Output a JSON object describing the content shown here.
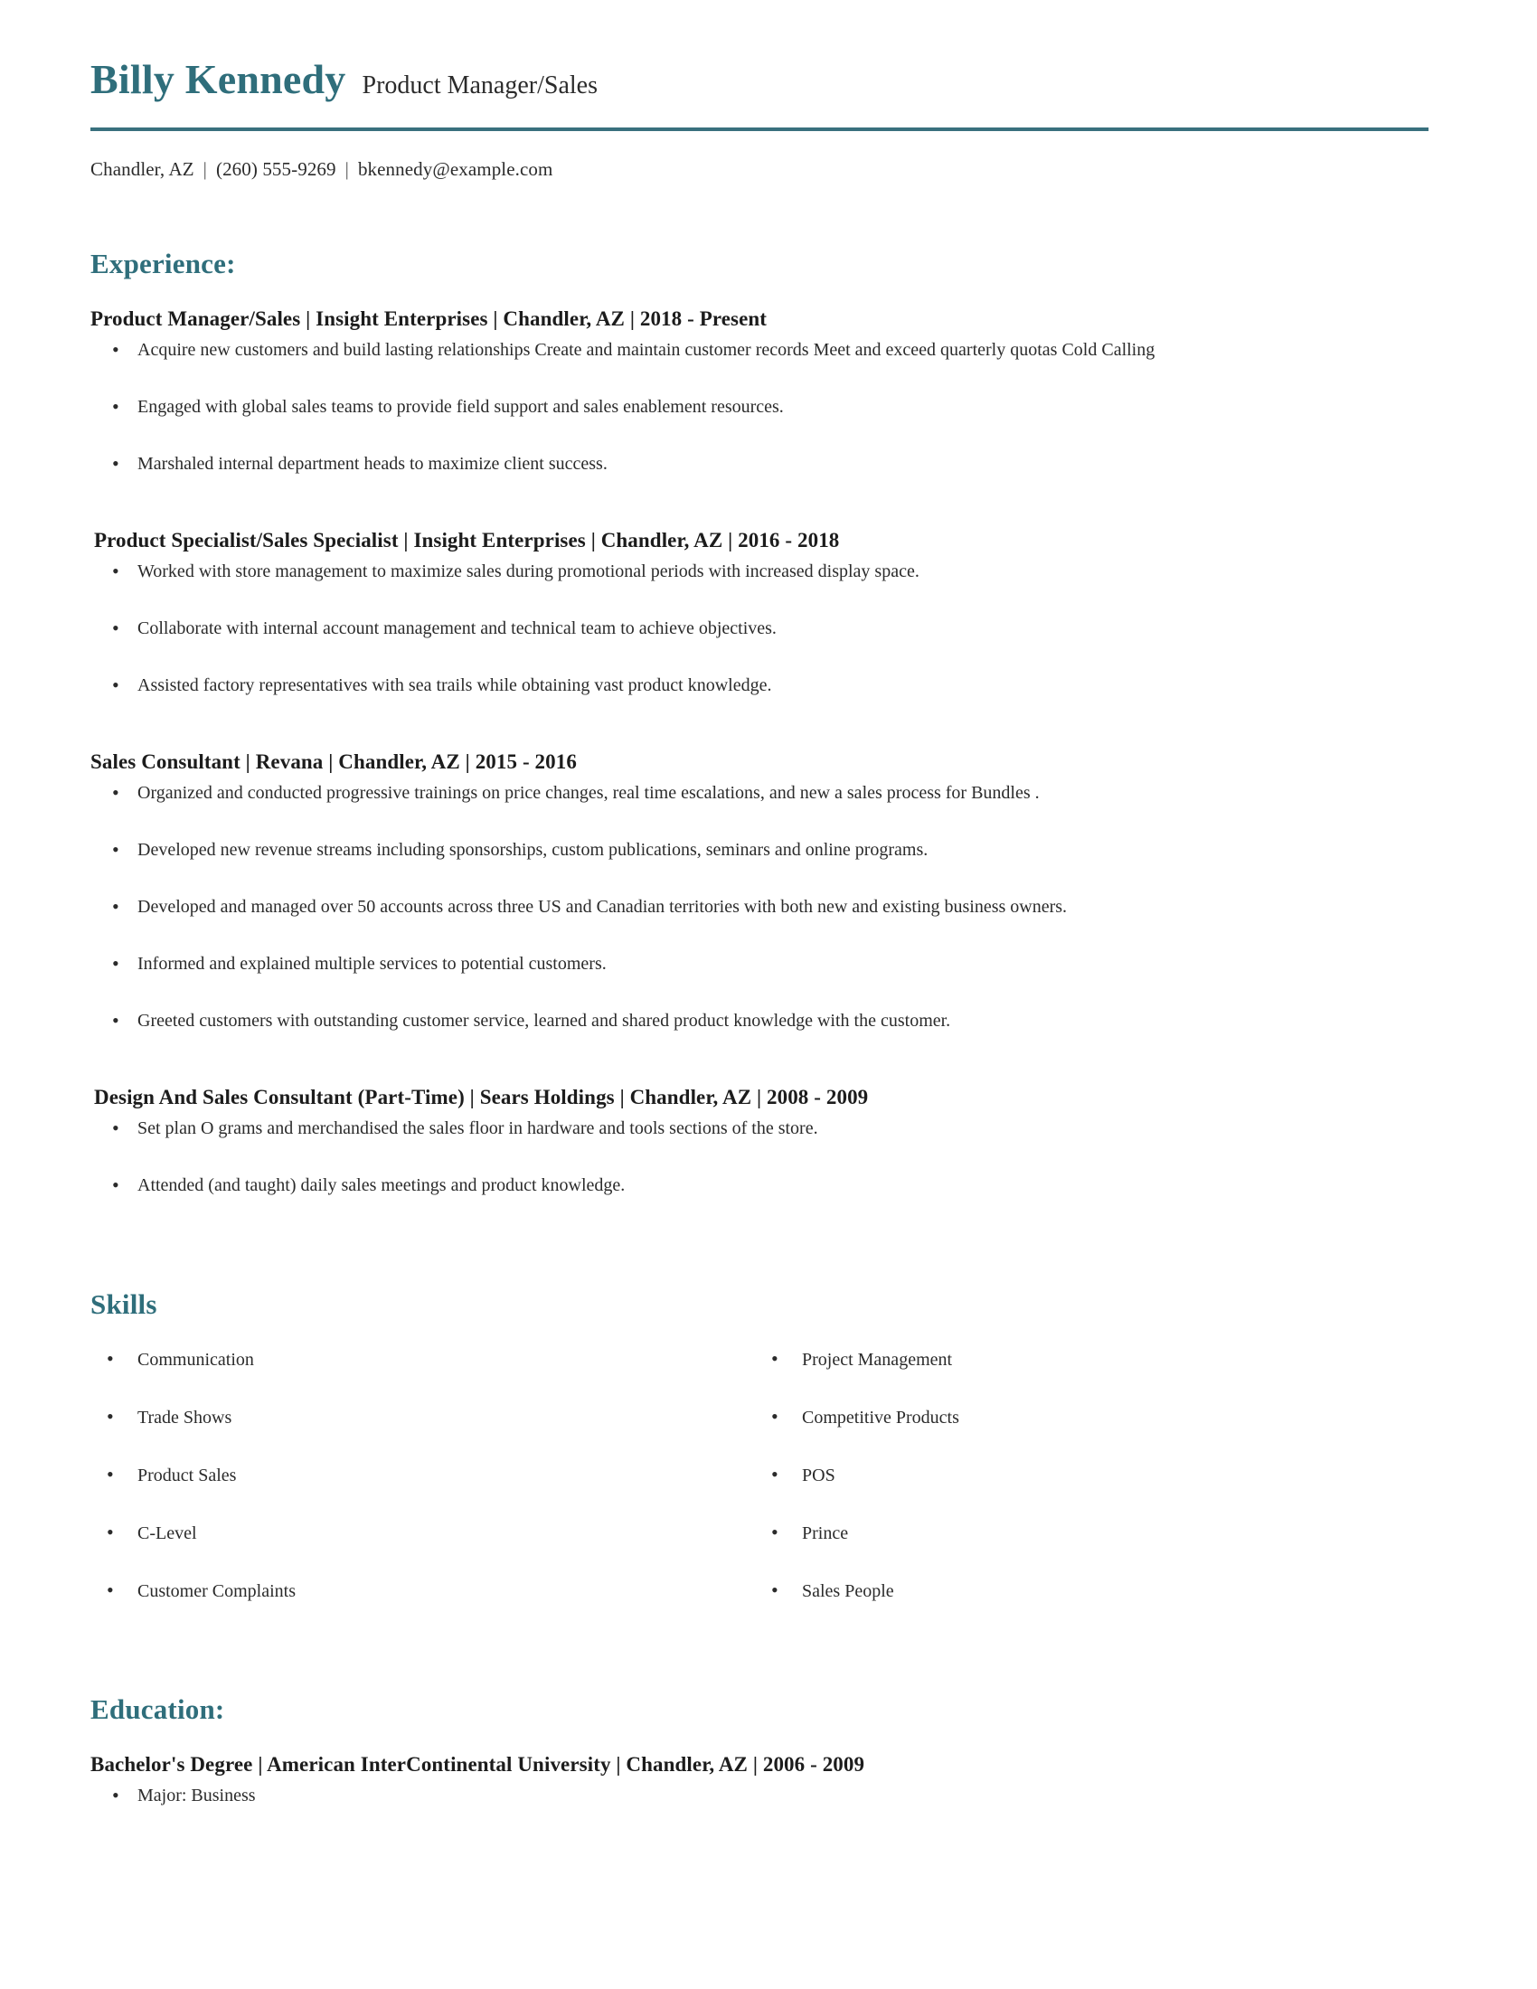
{
  "header": {
    "name": "Billy Kennedy",
    "headline": "Product Manager/Sales",
    "accent_color": "#2f6e7b",
    "rule_color": "#39707e"
  },
  "contact": {
    "location": "Chandler, AZ",
    "phone": "(260) 555-9269",
    "email": "bkennedy@example.com",
    "separator": "|"
  },
  "experience": {
    "title": "Experience:",
    "entries": [
      {
        "heading": "Product Manager/Sales | Insight Enterprises | Chandler, AZ | 2018 - Present",
        "bullets": [
          "Acquire new customers and build lasting relationships Create and maintain customer records Meet and exceed quarterly quotas Cold Calling",
          "Engaged with global sales teams to provide field support and sales enablement resources.",
          "Marshaled internal department heads to maximize client success."
        ]
      },
      {
        "heading": "Product Specialist/Sales Specialist | Insight Enterprises | Chandler, AZ |  2016 - 2018",
        "bullets": [
          "Worked with store management to maximize sales during promotional periods with increased display space.",
          "Collaborate with internal account management and technical team to achieve objectives.",
          "Assisted factory representatives with sea trails while obtaining vast product knowledge."
        ]
      },
      {
        "heading": "Sales Consultant | Revana | Chandler, AZ | 2015 - 2016",
        "bullets": [
          "Organized and conducted progressive trainings on price changes, real time escalations, and new a sales process for Bundles .",
          "Developed new revenue streams including sponsorships, custom publications, seminars and online programs.",
          "Developed and managed over 50 accounts across three US and Canadian territories with both new and existing business owners.",
          "Informed and explained multiple services to potential customers.",
          "Greeted customers with outstanding customer service, learned and shared product knowledge with the customer."
        ]
      },
      {
        "heading": "Design And Sales Consultant (Part-Time) | Sears Holdings | Chandler, AZ | 2008 - 2009",
        "bullets": [
          "Set plan O grams and merchandised the sales floor in hardware and tools sections of the store.",
          "Attended (and taught) daily sales meetings and product knowledge."
        ]
      }
    ]
  },
  "skills": {
    "title": "Skills",
    "left_column": [
      "Communication",
      "Trade Shows",
      "Product Sales",
      "C-Level",
      "Customer Complaints"
    ],
    "right_column": [
      "Project Management",
      "Competitive Products",
      "POS",
      "Prince",
      "Sales People"
    ]
  },
  "education": {
    "title": "Education:",
    "entries": [
      {
        "heading": "Bachelor's Degree | American InterContinental University | Chandler, AZ | 2006 - 2009",
        "bullets": [
          "Major: Business"
        ]
      }
    ]
  }
}
